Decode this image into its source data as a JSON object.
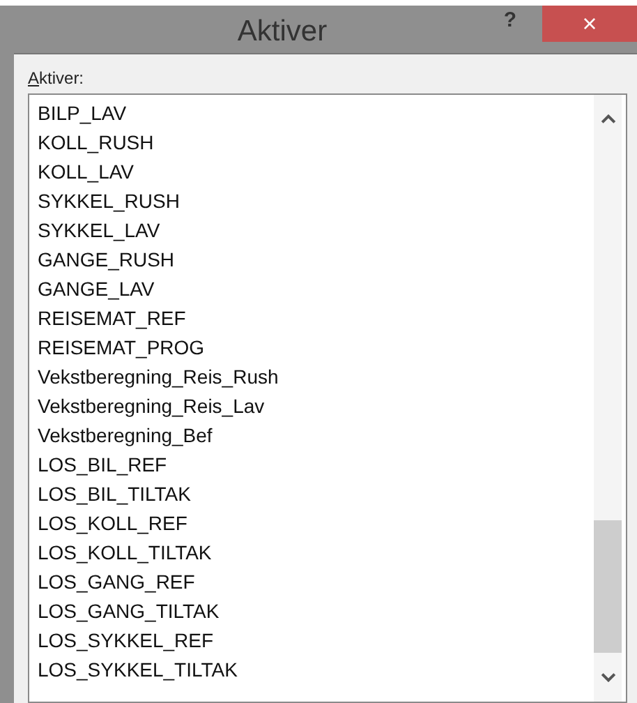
{
  "window": {
    "title": "Aktiver",
    "help": "?",
    "close": "×"
  },
  "list_label": "Aktiver:",
  "items": [
    "BILP_LAV",
    "KOLL_RUSH",
    "KOLL_LAV",
    "SYKKEL_RUSH",
    "SYKKEL_LAV",
    "GANGE_RUSH",
    "GANGE_LAV",
    "REISEMAT_REF",
    "REISEMAT_PROG",
    "Vekstberegning_Reis_Rush",
    "Vekstberegning_Reis_Lav",
    "Vekstberegning_Bef",
    "LOS_BIL_REF",
    "LOS_BIL_TILTAK",
    "LOS_KOLL_REF",
    "LOS_KOLL_TILTAK",
    "LOS_GANG_REF",
    "LOS_GANG_TILTAK",
    "LOS_SYKKEL_REF",
    "LOS_SYKKEL_TILTAK"
  ]
}
